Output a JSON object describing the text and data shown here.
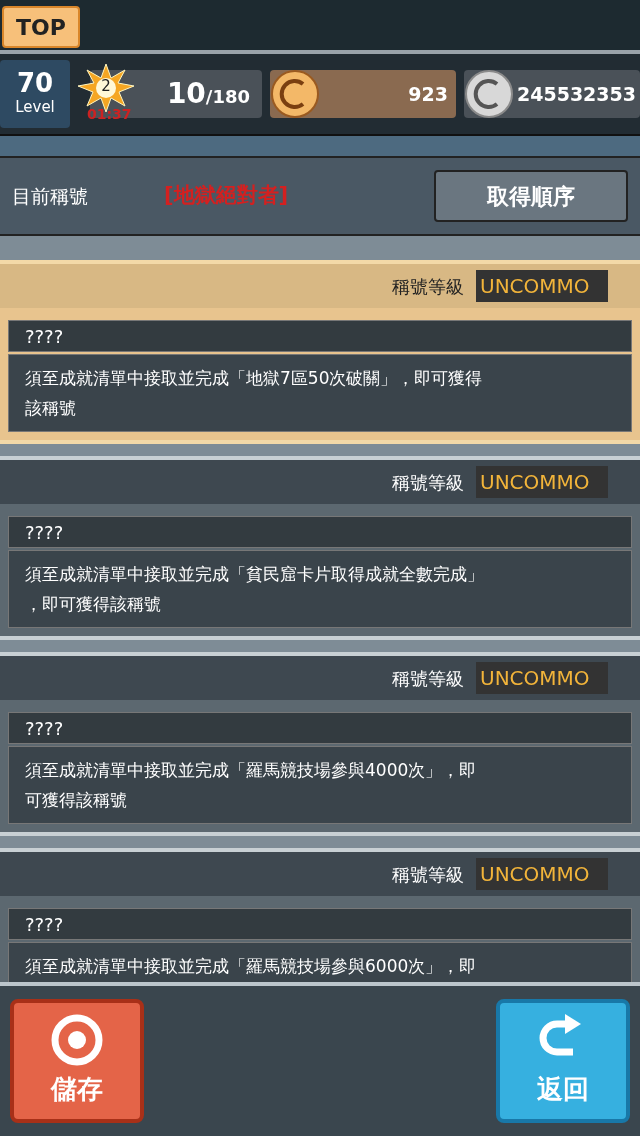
{
  "top_button": "TOP",
  "status": {
    "level": "70",
    "level_label": "Level",
    "stamina_badge": "2",
    "stamina_timer": "01:37",
    "stamina": "10",
    "stamina_max": "/180",
    "gold": "923",
    "silver": "245532353"
  },
  "current_title": {
    "label": "目前稱號",
    "value": "[地獄絕對者]",
    "order_button": "取得順序"
  },
  "titles": [
    {
      "rank_label": "稱號等級",
      "rank": "UNCOMMO",
      "name": "????",
      "description": [
        "須至成就清單中接取並完成「地獄7區50次破關」，即可獲得",
        "該稱號"
      ],
      "selected": true
    },
    {
      "rank_label": "稱號等級",
      "rank": "UNCOMMO",
      "name": "????",
      "description": [
        "須至成就清單中接取並完成「貧民窟卡片取得成就全數完成」",
        "，即可獲得該稱號"
      ],
      "selected": false
    },
    {
      "rank_label": "稱號等級",
      "rank": "UNCOMMO",
      "name": "????",
      "description": [
        "須至成就清單中接取並完成「羅馬競技場參與4000次」，即",
        "可獲得該稱號"
      ],
      "selected": false
    },
    {
      "rank_label": "稱號等級",
      "rank": "UNCOMMO",
      "name": "????",
      "description": [
        "須至成就清單中接取並完成「羅馬競技場參與6000次」，即"
      ],
      "selected": false
    }
  ],
  "buttons": {
    "save": "儲存",
    "back": "返回"
  }
}
